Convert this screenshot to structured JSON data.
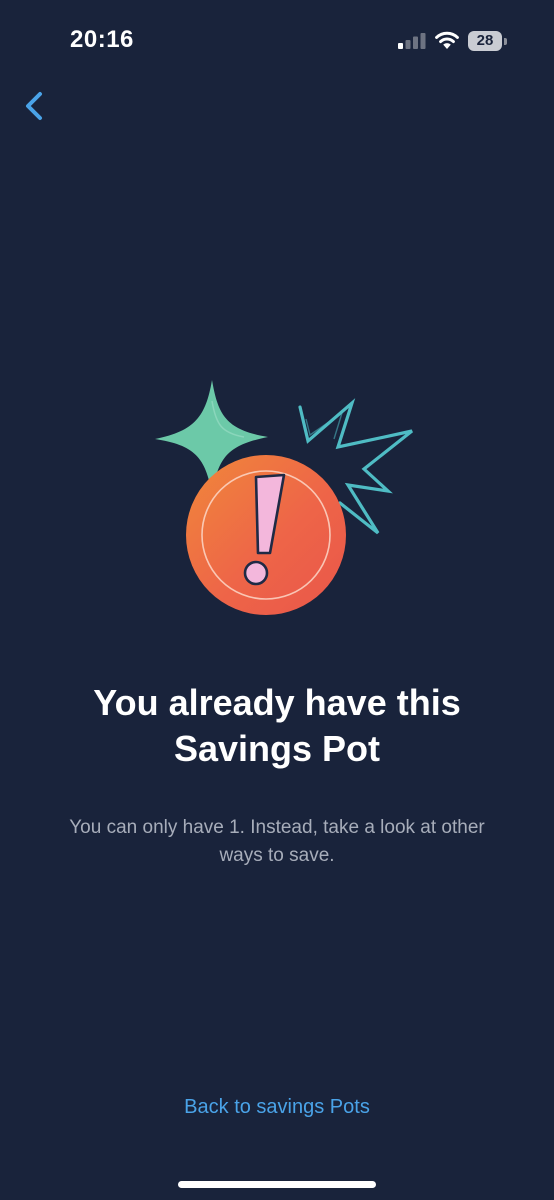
{
  "status_bar": {
    "time": "20:16",
    "battery_level": "28",
    "icons": [
      "signal-icon",
      "wifi-icon",
      "battery-icon"
    ]
  },
  "nav": {
    "back_icon": "chevron-left-icon"
  },
  "illustration": {
    "icons": [
      "sparkle-icon",
      "burst-icon",
      "exclamation-coin-icon"
    ],
    "exclamation": "!"
  },
  "content": {
    "title": "You already have this Savings Pot",
    "message": "You can only have 1. Instead, take a look at other ways to save."
  },
  "actions": {
    "back_to_pots": "Back to savings Pots"
  },
  "colors": {
    "background": "#19233b",
    "accent": "#4aa3e8",
    "text_primary": "#ffffff",
    "text_secondary": "#a7adba",
    "coin": "#ee6a4c",
    "sparkle": "#6cc9a8",
    "exclamation": "#f3b7dc"
  }
}
